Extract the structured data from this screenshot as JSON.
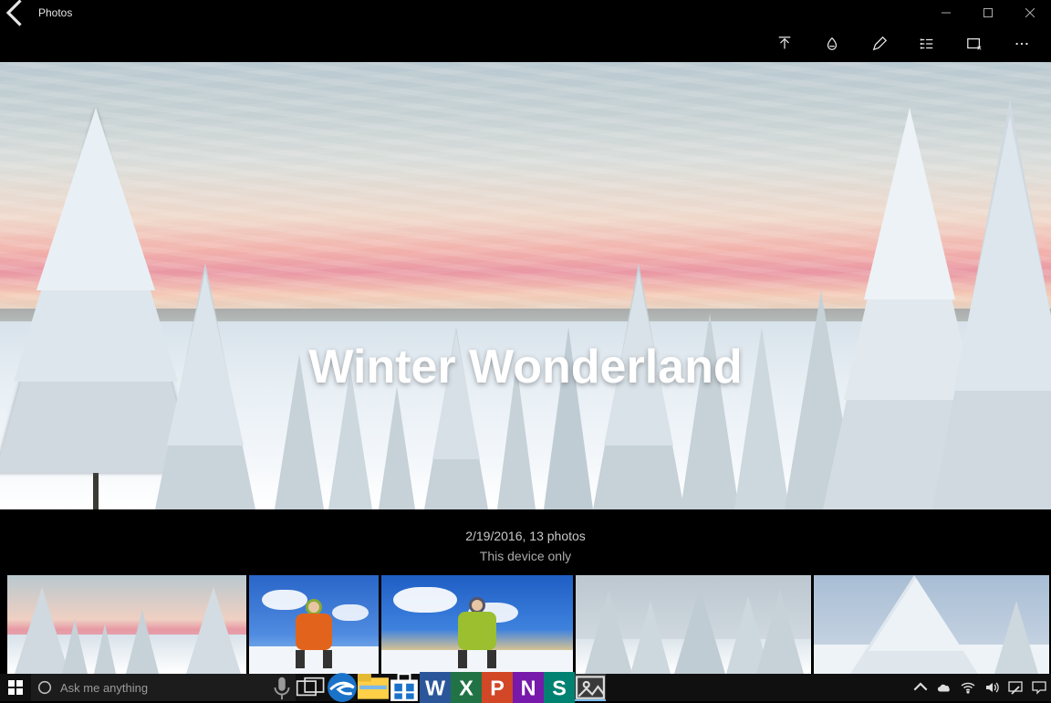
{
  "titlebar": {
    "app_name": "Photos"
  },
  "album": {
    "title": "Winter Wonderland",
    "date_line": "2/19/2016, 13 photos",
    "location_line": "This device only"
  },
  "toolbar_actions": [
    "share",
    "windows-ink",
    "edit",
    "add-to-album",
    "slideshow",
    "more"
  ],
  "thumbnails_count": 5,
  "taskbar": {
    "search_placeholder": "Ask me anything",
    "pinned_apps": [
      "task-view",
      "edge",
      "file-explorer",
      "store",
      "word",
      "excel",
      "powerpoint",
      "onenote",
      "sway",
      "photos"
    ]
  }
}
